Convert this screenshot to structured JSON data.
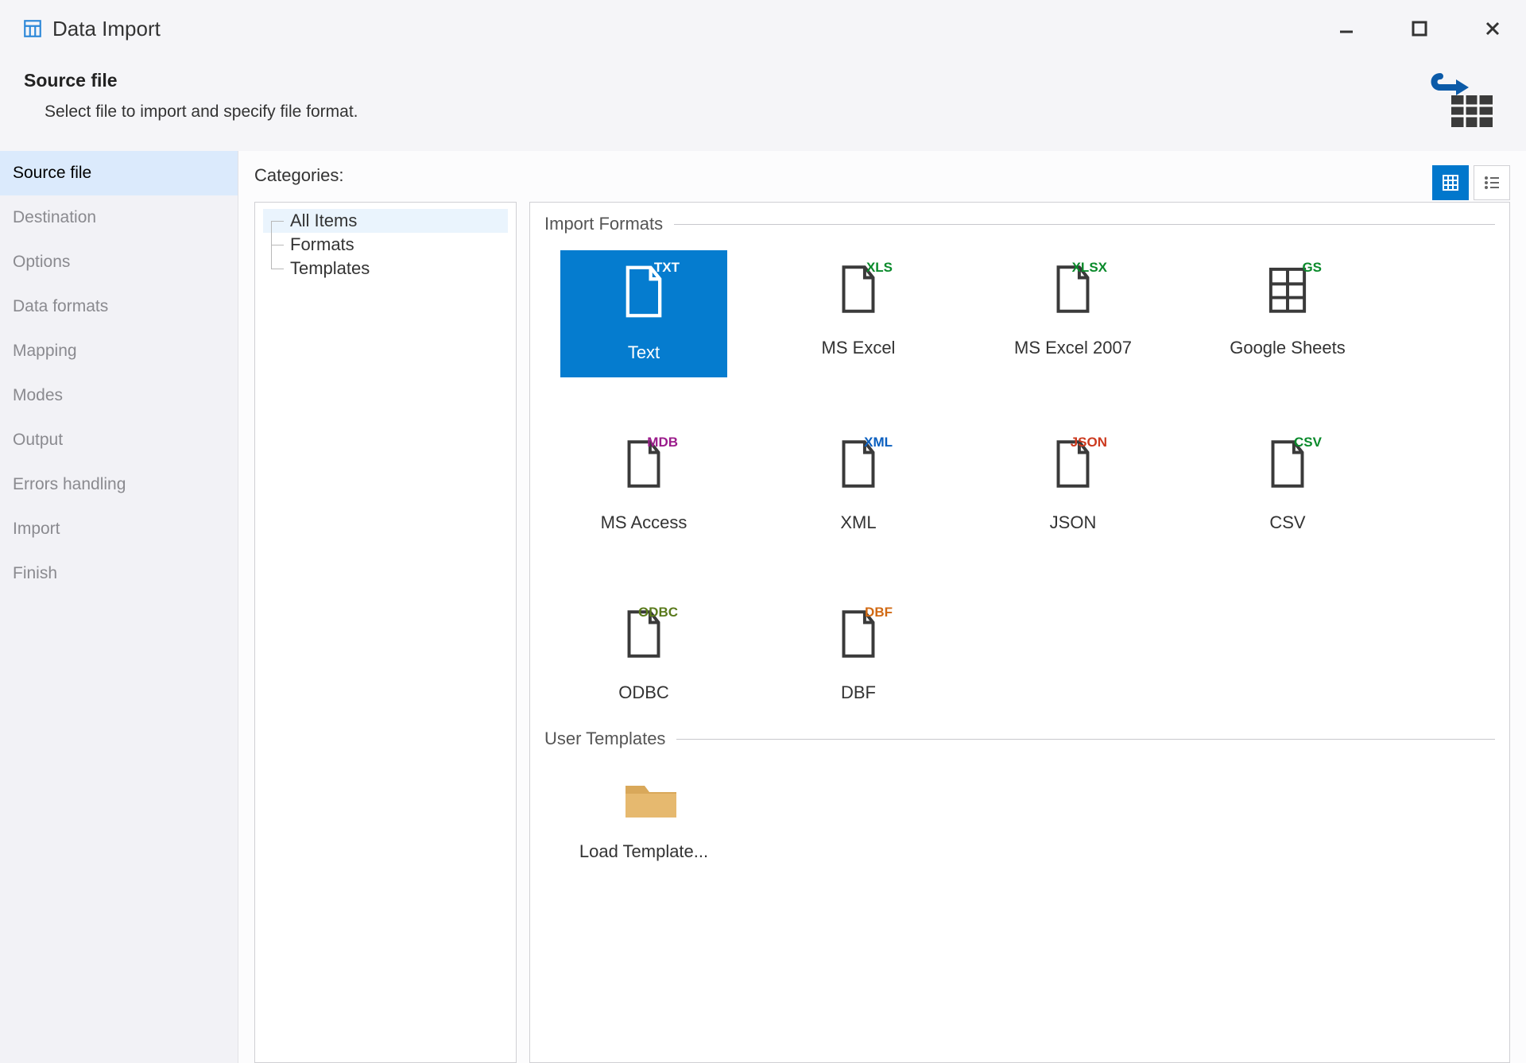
{
  "window": {
    "title": "Data Import"
  },
  "header": {
    "heading": "Source file",
    "subheading": "Select file to import and specify file format."
  },
  "sidebar": {
    "items": [
      {
        "label": "Source file",
        "active": true
      },
      {
        "label": "Destination"
      },
      {
        "label": "Options"
      },
      {
        "label": "Data formats"
      },
      {
        "label": "Mapping"
      },
      {
        "label": "Modes"
      },
      {
        "label": "Output"
      },
      {
        "label": "Errors handling"
      },
      {
        "label": "Import"
      },
      {
        "label": "Finish"
      }
    ]
  },
  "categories": {
    "label": "Categories:",
    "tree": [
      {
        "label": "All Items",
        "active": true
      },
      {
        "label": "Formats"
      },
      {
        "label": "Templates"
      }
    ]
  },
  "groups": {
    "formats": {
      "label": "Import Formats",
      "items": [
        {
          "label": "Text",
          "ext": "TXT",
          "ext_color": "#ffffff",
          "selected": true
        },
        {
          "label": "MS Excel",
          "ext": "XLS",
          "ext_color": "#0a8a2b"
        },
        {
          "label": "MS Excel 2007",
          "ext": "XLSX",
          "ext_color": "#0a8a2b"
        },
        {
          "label": "Google Sheets",
          "ext": "GS",
          "ext_color": "#0a8a2b",
          "sheet": true
        },
        {
          "label": "MS Access",
          "ext": "MDB",
          "ext_color": "#9b1c8b"
        },
        {
          "label": "XML",
          "ext": "XML",
          "ext_color": "#0a5fbf"
        },
        {
          "label": "JSON",
          "ext": "JSON",
          "ext_color": "#cc3a1f"
        },
        {
          "label": "CSV",
          "ext": "CSV",
          "ext_color": "#0a8a2b"
        },
        {
          "label": "ODBC",
          "ext": "ODBC",
          "ext_color": "#5a7a1c"
        },
        {
          "label": "DBF",
          "ext": "DBF",
          "ext_color": "#d16a14"
        }
      ]
    },
    "templates": {
      "label": "User Templates",
      "items": [
        {
          "label": "Load Template...",
          "folder": true
        }
      ]
    }
  }
}
